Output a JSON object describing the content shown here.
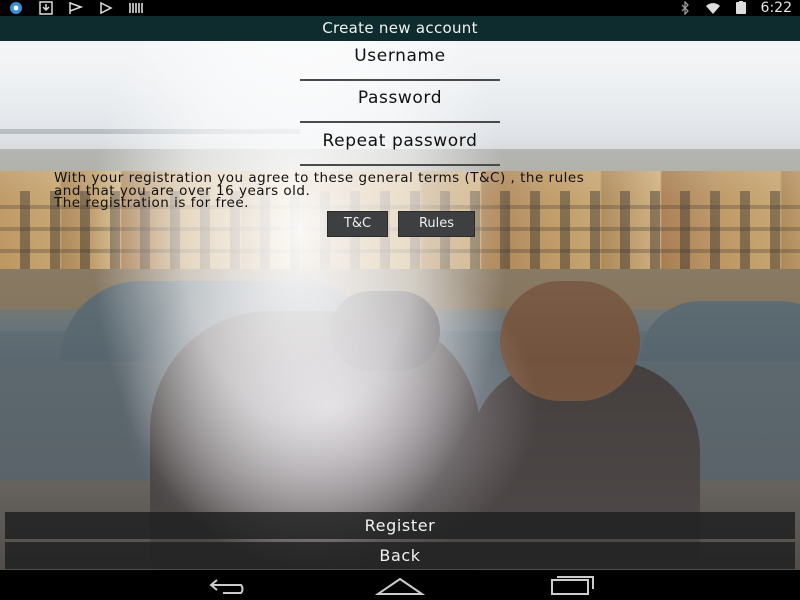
{
  "status_bar": {
    "time": "6:22",
    "left_icons": [
      "app-notification-icon",
      "download-icon",
      "muted-flag-icon",
      "play-icon",
      "barcode-icon"
    ],
    "right_icons": [
      "bluetooth-icon",
      "wifi-icon",
      "battery-icon"
    ]
  },
  "header": {
    "title": "Create new account"
  },
  "form": {
    "username_label": "Username",
    "password_label": "Password",
    "repeat_password_label": "Repeat password"
  },
  "terms": {
    "line1": "With your registration you agree to these general terms (T&C) , the rules",
    "line2": "and that you are over 16 years old.",
    "line3": "The registration is for free."
  },
  "buttons": {
    "tc": "T&C",
    "rules": "Rules",
    "register": "Register",
    "back": "Back"
  },
  "nav_bar": {
    "icons": [
      "nav-back-icon",
      "nav-home-icon",
      "nav-recent-apps-icon"
    ]
  },
  "colors": {
    "title_bar": "#0e2c2e",
    "button_bg": "#3e3f41",
    "status_bar": "#000000"
  }
}
